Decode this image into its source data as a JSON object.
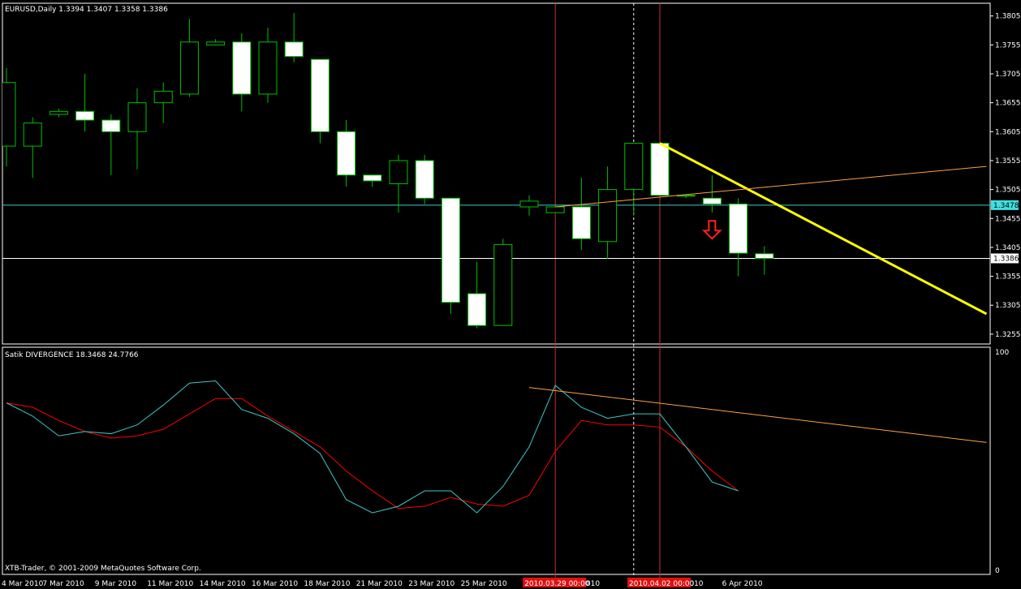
{
  "window": {
    "price_header": "EURUSD,Daily  1.3394 1.3407 1.3358 1.3386",
    "indicator_header": "Satik DIVERGENCE 18.3468 24.7766",
    "copyright": "XTB-Trader, © 2001-2009 MetaQuotes Software Corp."
  },
  "colors": {
    "background": "#000000",
    "grid_frame": "#ffffff",
    "candle_bull_body": "#000000",
    "candle_bear_body": "#ffffff",
    "candle_outline": "#00c000",
    "bid_line": "#40c8c8",
    "trend_yellow": "#ffff00",
    "trend_orange": "#ffa040",
    "vline_red": "#c03030",
    "signal_red": "#ff2020",
    "indicator_red": "#ff0000",
    "indicator_cyan": "#40c8c8",
    "tag_bid_bg": "#40e0e0"
  },
  "price_axis": {
    "ticks": [
      "1.3805",
      "1.3755",
      "1.3705",
      "1.3655",
      "1.3605",
      "1.3555",
      "1.3505",
      "1.3455",
      "1.3405",
      "1.3355",
      "1.3305",
      "1.3255"
    ],
    "range": [
      1.3238,
      1.3827
    ],
    "bid_tag": "1.3478",
    "close_tag": "1.3386"
  },
  "indicator_axis": {
    "top_label": "100",
    "bottom_label": "0"
  },
  "time_axis": {
    "labels": [
      "4 Mar 2010",
      "7 Mar 2010",
      "9 Mar 2010",
      "11 Mar 2010",
      "14 Mar 2010",
      "16 Mar 2010",
      "18 Mar 2010",
      "21 Mar 2010",
      "23 Mar 2010",
      "25 Mar 2010",
      "Mar 2010",
      "Apr 2010",
      "6 Apr 2010"
    ],
    "highlight_1": "2010.03.29 00:00",
    "highlight_2": "2010.04.02 00:00"
  },
  "chart_data": {
    "type": "candlestick",
    "symbol": "EURUSD",
    "timeframe": "Daily",
    "candles": [
      {
        "o": 1.358,
        "h": 1.3715,
        "l": 1.3545,
        "c": 1.369
      },
      {
        "o": 1.358,
        "h": 1.363,
        "l": 1.3525,
        "c": 1.362
      },
      {
        "o": 1.3635,
        "h": 1.3645,
        "l": 1.363,
        "c": 1.364
      },
      {
        "o": 1.364,
        "h": 1.3705,
        "l": 1.3605,
        "c": 1.3625
      },
      {
        "o": 1.3625,
        "h": 1.3635,
        "l": 1.353,
        "c": 1.3605
      },
      {
        "o": 1.3605,
        "h": 1.368,
        "l": 1.354,
        "c": 1.3655
      },
      {
        "o": 1.3655,
        "h": 1.369,
        "l": 1.362,
        "c": 1.3675
      },
      {
        "o": 1.367,
        "h": 1.38,
        "l": 1.3665,
        "c": 1.376
      },
      {
        "o": 1.3755,
        "h": 1.3765,
        "l": 1.3755,
        "c": 1.376
      },
      {
        "o": 1.376,
        "h": 1.3775,
        "l": 1.364,
        "c": 1.367
      },
      {
        "o": 1.367,
        "h": 1.3785,
        "l": 1.3655,
        "c": 1.376
      },
      {
        "o": 1.376,
        "h": 1.381,
        "l": 1.3725,
        "c": 1.3735
      },
      {
        "o": 1.373,
        "h": 1.373,
        "l": 1.3585,
        "c": 1.3605
      },
      {
        "o": 1.3605,
        "h": 1.3625,
        "l": 1.351,
        "c": 1.353
      },
      {
        "o": 1.353,
        "h": 1.353,
        "l": 1.351,
        "c": 1.352
      },
      {
        "o": 1.3515,
        "h": 1.3565,
        "l": 1.3465,
        "c": 1.3555
      },
      {
        "o": 1.3555,
        "h": 1.3565,
        "l": 1.348,
        "c": 1.349
      },
      {
        "o": 1.349,
        "h": 1.349,
        "l": 1.329,
        "c": 1.331
      },
      {
        "o": 1.3325,
        "h": 1.338,
        "l": 1.3265,
        "c": 1.327
      },
      {
        "o": 1.327,
        "h": 1.342,
        "l": 1.327,
        "c": 1.341
      },
      {
        "o": 1.3475,
        "h": 1.3495,
        "l": 1.346,
        "c": 1.3485
      },
      {
        "o": 1.3465,
        "h": 1.348,
        "l": 1.3465,
        "c": 1.3475
      },
      {
        "o": 1.3475,
        "h": 1.3525,
        "l": 1.34,
        "c": 1.342
      },
      {
        "o": 1.3415,
        "h": 1.3545,
        "l": 1.3385,
        "c": 1.3505
      },
      {
        "o": 1.3505,
        "h": 1.3585,
        "l": 1.346,
        "c": 1.3585
      },
      {
        "o": 1.3585,
        "h": 1.3585,
        "l": 1.3495,
        "c": 1.3495
      },
      {
        "o": 1.3495,
        "h": 1.3495,
        "l": 1.349,
        "c": 1.3495
      },
      {
        "o": 1.349,
        "h": 1.353,
        "l": 1.3465,
        "c": 1.348
      },
      {
        "o": 1.348,
        "h": 1.349,
        "l": 1.3355,
        "c": 1.3395
      },
      {
        "o": 1.3394,
        "h": 1.3407,
        "l": 1.3358,
        "c": 1.3386
      }
    ],
    "trendlines": [
      {
        "color": "yellow",
        "from": {
          "bar": 25,
          "price": 1.3585
        },
        "to": {
          "bar": 37.5,
          "price": 1.329
        }
      },
      {
        "color": "orange",
        "from": {
          "bar": 21,
          "price": 1.3475
        },
        "to": {
          "bar": 37.5,
          "price": 1.3545
        }
      }
    ],
    "hlines": [
      {
        "price": 1.3478,
        "color": "cyan"
      },
      {
        "price": 1.3386,
        "color": "white"
      }
    ],
    "vlines": [
      {
        "bar": 21,
        "style": "solid",
        "color": "red"
      },
      {
        "bar": 24,
        "style": "dashed",
        "color": "white"
      },
      {
        "bar": 25,
        "style": "solid",
        "color": "red"
      }
    ],
    "sell_arrow": {
      "bar": 27,
      "price": 1.342
    },
    "indicator": {
      "name": "Satik DIVERGENCE",
      "range": [
        0,
        100
      ],
      "red": [
        78,
        76,
        70,
        65,
        62,
        63,
        66,
        73,
        80,
        80,
        72,
        65,
        58,
        47,
        38,
        30,
        31,
        35,
        32,
        31,
        36,
        56,
        70,
        68,
        68,
        67,
        58,
        47,
        38
      ],
      "cyan": [
        78,
        72,
        63,
        65,
        64,
        68,
        77,
        87,
        88,
        75,
        71,
        64,
        55,
        34,
        28,
        31,
        38,
        38,
        28,
        40,
        58,
        86,
        76,
        71,
        73,
        73,
        58,
        42,
        38
      ],
      "trend_orange": {
        "from": {
          "bar": 20,
          "value": 85
        },
        "to": {
          "bar": 37.5,
          "value": 60
        }
      }
    }
  }
}
